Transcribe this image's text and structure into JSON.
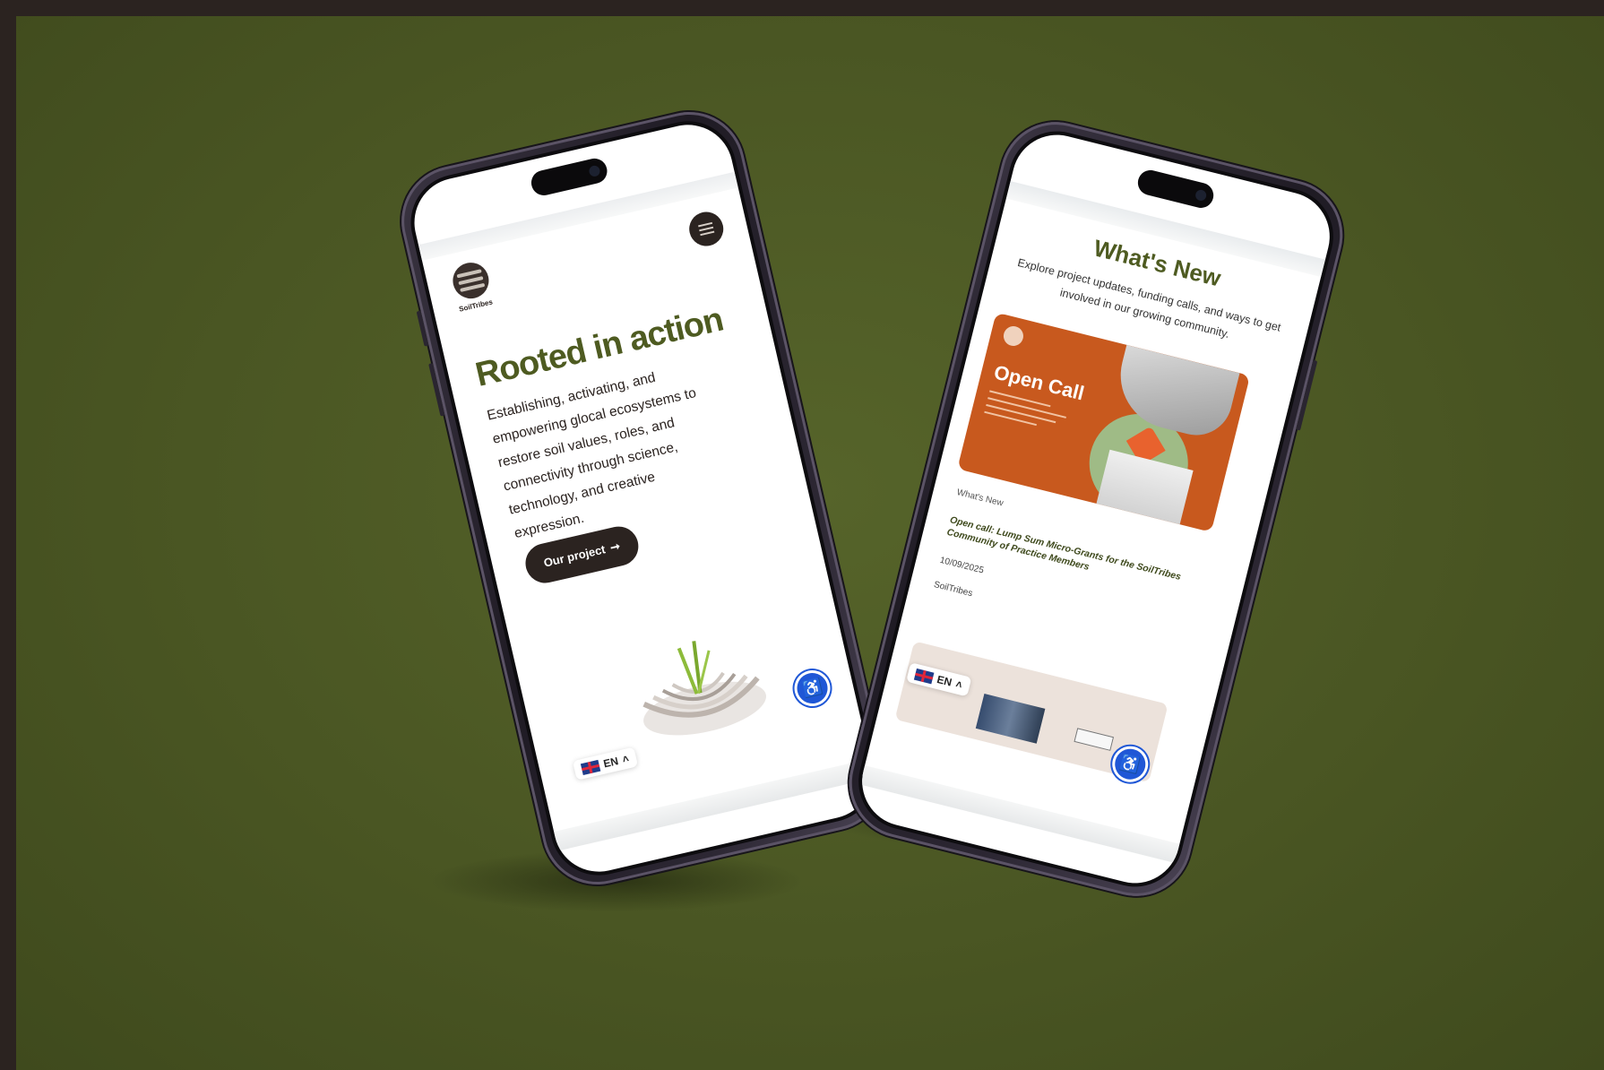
{
  "phone_home": {
    "logo_text": "SoilTribes",
    "menu_icon": "hamburger-menu-icon",
    "hero_title": "Rooted in action",
    "hero_text": "Establishing, activating, and empowering glocal ecosystems to restore soil values, roles, and connectivity through science, technology, and creative expression.",
    "cta_label": "Our project",
    "cta_icon": "arrow-right-icon",
    "language": "EN",
    "accessibility_icon": "accessibility-icon"
  },
  "phone_news": {
    "title": "What's New",
    "subtitle": "Explore project updates, funding calls, and ways to get involved in our growing community.",
    "card": {
      "image_title": "Open Call",
      "tag": "What's New",
      "heading": "Open call: Lump Sum Micro-Grants for the SoilTribes Community of Practice Members",
      "date": "10/09/2025",
      "author": "SoilTribes"
    },
    "language": "EN",
    "accessibility_icon": "accessibility-icon"
  },
  "colors": {
    "background": "#4a5623",
    "brand_green": "#4e5b21",
    "dark_brown": "#2b2320",
    "accent_orange": "#c8591e",
    "accessibility_blue": "#1f57d6"
  }
}
